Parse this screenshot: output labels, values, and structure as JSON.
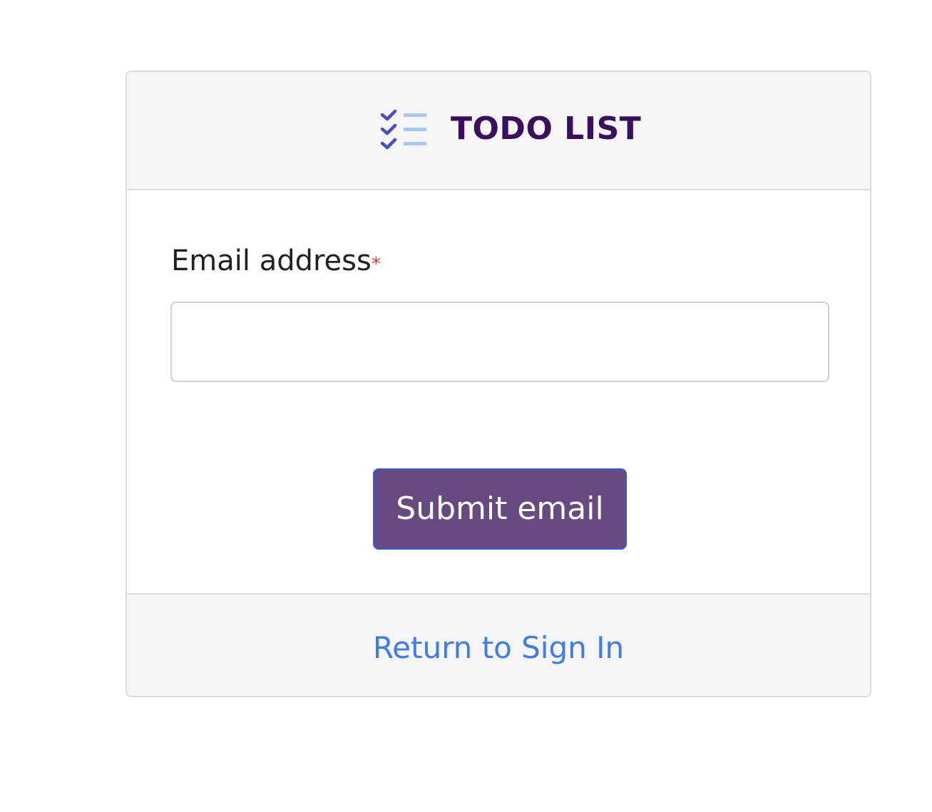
{
  "header": {
    "icon": "checklist-icon",
    "title": "TODO LIST"
  },
  "form": {
    "email_label": "Email address",
    "required_marker": "*",
    "email_value": "",
    "email_placeholder": "",
    "submit_label": "Submit email"
  },
  "footer": {
    "return_link": "Return to Sign In"
  },
  "colors": {
    "brand_title": "#3a0f5f",
    "icon_check": "#4a4fbf",
    "icon_lines": "#a8c8f8",
    "button_bg": "#674a80",
    "button_border": "#2f5fd0",
    "link": "#3f7bef",
    "required": "#e53935"
  }
}
